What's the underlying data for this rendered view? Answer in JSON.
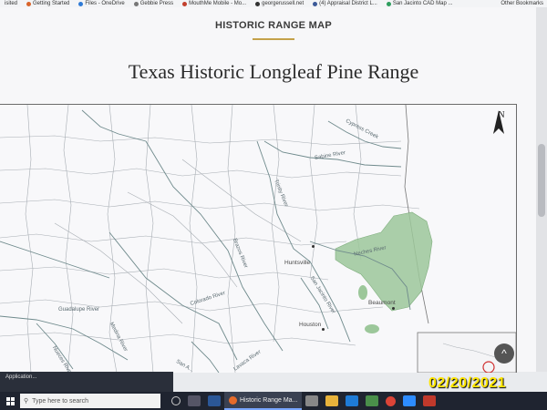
{
  "bookmarks": {
    "items": [
      {
        "label": "isited",
        "color": "#999999"
      },
      {
        "label": "Getting Started",
        "color": "#d9642a"
      },
      {
        "label": "Files - OneDrive",
        "color": "#2f7ad6"
      },
      {
        "label": "Gebbie Press",
        "color": "#777777"
      },
      {
        "label": "MouthMe Mobile - Mo...",
        "color": "#c2402d"
      },
      {
        "label": "georgerussell.net",
        "color": "#333333"
      },
      {
        "label": "(4) Appraisal District L...",
        "color": "#3b5998"
      },
      {
        "label": "San Jacinto CAD Map ...",
        "color": "#2d9d5d"
      }
    ],
    "other": "Other Bookmarks"
  },
  "page": {
    "header_title": "HISTORIC RANGE MAP",
    "map_title": "Texas Historic Longleaf Pine Range"
  },
  "map": {
    "north_label": "N",
    "rivers": {
      "cypress": "Cypress Creek",
      "sabine": "Sabine River",
      "trinity": "Trinity River",
      "neches": "Neches River",
      "brazos": "Brazos River",
      "sanjacinto": "San Jacinto River",
      "colorado": "Colorado River",
      "guadalupe": "Guadalupe River",
      "medina": "Medina River",
      "nueces": "Nueces River",
      "lavaca": "Lavaca River",
      "sanantonio": "San A..."
    },
    "cities": {
      "huntsville": "Huntsville",
      "beaumont": "Beaumont",
      "houston": "Houston"
    },
    "range_color": "#9cc79a"
  },
  "taskbar": {
    "search_placeholder": "Type here to search",
    "active_app": "Historic Range Ma...",
    "app_tip": "Application..."
  },
  "overlay": {
    "date_stamp": "02/20/2021"
  }
}
